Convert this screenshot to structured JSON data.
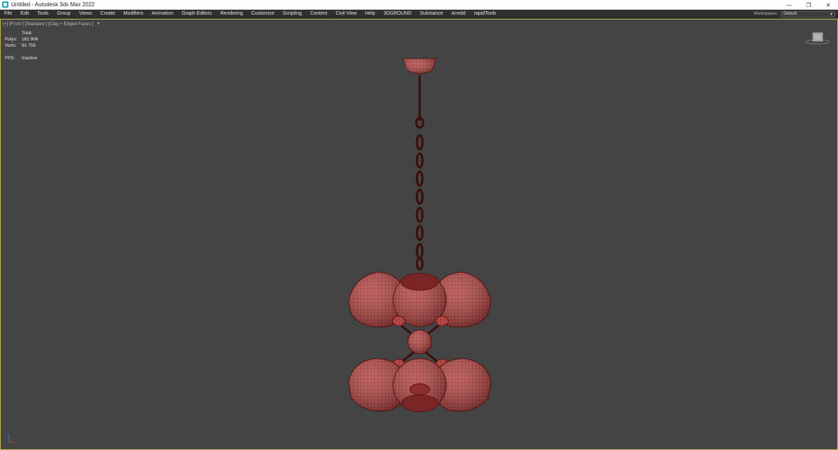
{
  "window": {
    "title": "Untitled - Autodesk 3ds Max 2022",
    "controls": {
      "minimize": "—",
      "restore": "❐",
      "close": "✕"
    }
  },
  "menu": {
    "items": [
      "File",
      "Edit",
      "Tools",
      "Group",
      "Views",
      "Create",
      "Modifiers",
      "Animation",
      "Graph Editors",
      "Rendering",
      "Customize",
      "Scripting",
      "Content",
      "Civil View",
      "Help",
      "3DGROUND",
      "Substance",
      "Arnold",
      "rapidTools"
    ],
    "workspaces_label": "Workspaces:",
    "workspace_value": "Default"
  },
  "viewport": {
    "label": "[+] [Front ] [Standard ] [Clay + Edged Faces ]",
    "stats": {
      "header": "Total",
      "polys_label": "Polys:",
      "polys_value": "181 906",
      "verts_label": "Verts:",
      "verts_value": "91 759",
      "fps_label": "FPS:",
      "fps_value": "Inactive"
    }
  },
  "colors": {
    "viewport_bg": "#444444",
    "model_fill": "#b84a47",
    "model_wire": "#5a1414",
    "active_border": "#c9b94a"
  }
}
